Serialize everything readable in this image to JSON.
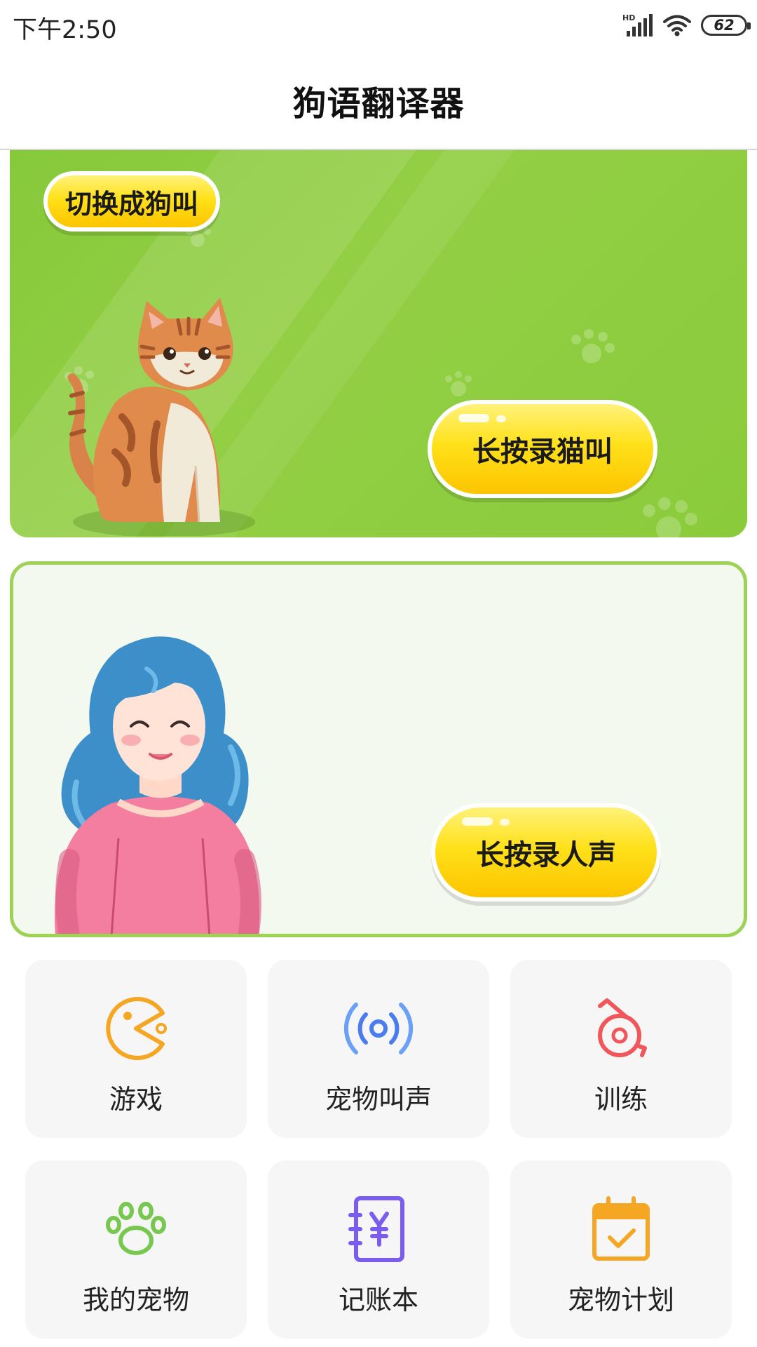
{
  "status_bar": {
    "time": "下午2:50",
    "network_label": "HD",
    "battery_level": "62",
    "icons": [
      "signal-icon",
      "wifi-icon",
      "battery-icon"
    ]
  },
  "header": {
    "title": "狗语翻译器"
  },
  "cat_panel": {
    "switch_label": "切换成狗叫",
    "record_label": "长按录猫叫",
    "illustration": "cat-illustration"
  },
  "human_panel": {
    "record_label": "长按录人声",
    "illustration": "woman-illustration"
  },
  "features": [
    {
      "label": "游戏",
      "icon": "pacman-icon",
      "color": "#f5a623"
    },
    {
      "label": "宠物叫声",
      "icon": "broadcast-icon",
      "color": "#4a7cf0"
    },
    {
      "label": "训练",
      "icon": "whistle-icon",
      "color": "#f0565a"
    },
    {
      "label": "我的宠物",
      "icon": "paw-icon",
      "color": "#78c850"
    },
    {
      "label": "记账本",
      "icon": "ledger-icon",
      "color": "#7a5cf0"
    },
    {
      "label": "宠物计划",
      "icon": "calendar-icon",
      "color": "#f5a623"
    }
  ],
  "colors": {
    "panel_green": "#8ccb3c",
    "button_yellow": "#ffe11a",
    "panel_border": "#9ed256"
  }
}
